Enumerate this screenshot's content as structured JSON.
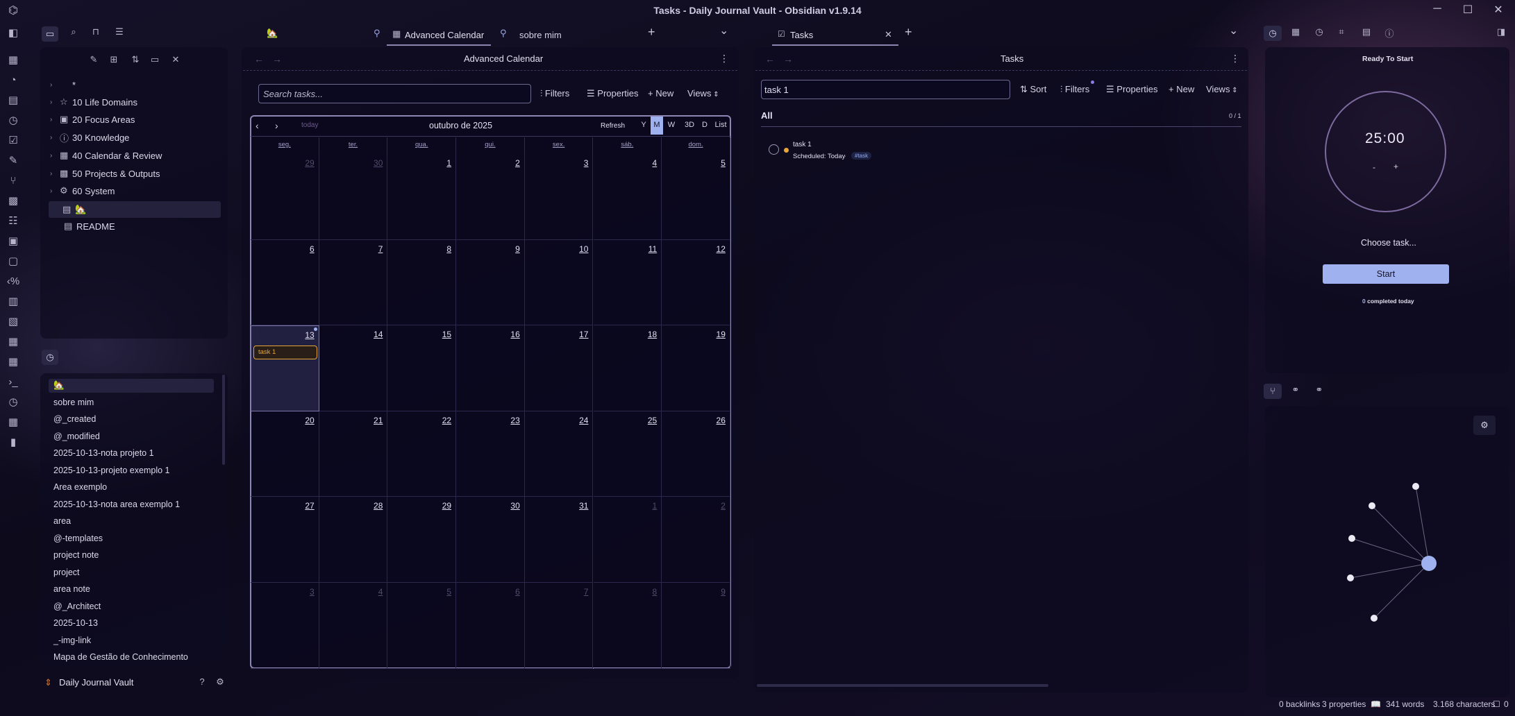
{
  "window": {
    "title": "Tasks - Daily Journal Vault - Obsidian v1.9.14",
    "minimize": "─",
    "maximize": "☐",
    "close": "✕"
  },
  "tabs": {
    "left": [
      {
        "label": "🏡"
      },
      {
        "label": "Advanced Calendar"
      },
      {
        "label": "sobre mim"
      }
    ],
    "right": [
      {
        "label": "Tasks"
      }
    ],
    "new_tab": "+",
    "dropdown": "⌄",
    "close": "✕"
  },
  "file_tree": {
    "items": [
      {
        "label": "*",
        "icon": "none"
      },
      {
        "label": "10 Life Domains",
        "icon": "star-icon"
      },
      {
        "label": "20 Focus Areas",
        "icon": "save-icon"
      },
      {
        "label": "30 Knowledge",
        "icon": "info-icon"
      },
      {
        "label": "40 Calendar & Review",
        "icon": "calendar-icon"
      },
      {
        "label": "50 Projects & Outputs",
        "icon": "grid-icon"
      },
      {
        "label": "60 System",
        "icon": "gear-icon"
      },
      {
        "label": "🏡",
        "icon": "file-icon"
      },
      {
        "label": "README",
        "icon": "file-icon"
      }
    ]
  },
  "recent_files": [
    "🏡",
    "sobre mim",
    "@_created",
    "@_modified",
    "2025-10-13-nota projeto 1",
    "2025-10-13-projeto exemplo 1",
    "Area exemplo",
    "2025-10-13-nota area exemplo 1",
    "area",
    "@-templates",
    "project note",
    "project",
    "area note",
    "@_Architect",
    "2025-10-13",
    "_-img-link",
    "Mapa de Gestão de Conhecimento"
  ],
  "vault": {
    "name": "Daily Journal Vault"
  },
  "calendar": {
    "view_title": "Advanced Calendar",
    "search_placeholder": "Search tasks...",
    "filters": "Filters",
    "properties": "Properties",
    "new": "New",
    "views": "Views",
    "today": "today",
    "month_title": "outubro de 2025",
    "refresh": "Refresh",
    "views_buttons": [
      "Y",
      "M",
      "W",
      "3D",
      "D",
      "List"
    ],
    "active_view": "M",
    "weekdays": [
      "seg.",
      "ter.",
      "qua.",
      "qui.",
      "sex.",
      "sáb.",
      "dom."
    ],
    "weeks": [
      [
        {
          "d": "29",
          "dim": true
        },
        {
          "d": "30",
          "dim": true
        },
        {
          "d": "1"
        },
        {
          "d": "2"
        },
        {
          "d": "3"
        },
        {
          "d": "4"
        },
        {
          "d": "5"
        }
      ],
      [
        {
          "d": "6"
        },
        {
          "d": "7"
        },
        {
          "d": "8"
        },
        {
          "d": "9"
        },
        {
          "d": "10"
        },
        {
          "d": "11"
        },
        {
          "d": "12"
        }
      ],
      [
        {
          "d": "13",
          "today": true
        },
        {
          "d": "14"
        },
        {
          "d": "15"
        },
        {
          "d": "16"
        },
        {
          "d": "17"
        },
        {
          "d": "18"
        },
        {
          "d": "19"
        }
      ],
      [
        {
          "d": "20"
        },
        {
          "d": "21"
        },
        {
          "d": "22"
        },
        {
          "d": "23"
        },
        {
          "d": "24"
        },
        {
          "d": "25"
        },
        {
          "d": "26"
        }
      ],
      [
        {
          "d": "27"
        },
        {
          "d": "28"
        },
        {
          "d": "29"
        },
        {
          "d": "30"
        },
        {
          "d": "31"
        },
        {
          "d": "1",
          "dim": true
        },
        {
          "d": "2",
          "dim": true
        }
      ],
      [
        {
          "d": "3",
          "dim": true
        },
        {
          "d": "4",
          "dim": true
        },
        {
          "d": "5",
          "dim": true
        },
        {
          "d": "6",
          "dim": true
        },
        {
          "d": "7",
          "dim": true
        },
        {
          "d": "8",
          "dim": true
        },
        {
          "d": "9",
          "dim": true
        }
      ]
    ],
    "event": {
      "label": "task 1",
      "color": "#e8a53a"
    }
  },
  "tasks": {
    "view_title": "Tasks",
    "search_value": "task 1",
    "sort": "Sort",
    "filters": "Filters",
    "properties": "Properties",
    "new": "New",
    "views": "Views",
    "group": "All",
    "count": "0 / 1",
    "items": [
      {
        "title": "task 1",
        "scheduled": "Scheduled: Today",
        "tag": "#task"
      }
    ]
  },
  "pomodoro": {
    "status": "Ready To Start",
    "time": "25:00",
    "minus": "-",
    "plus": "+",
    "choose": "Choose task...",
    "start": "Start",
    "completed_num": "0",
    "completed_label": "completed today"
  },
  "status": {
    "backlinks": "0 backlinks",
    "properties": "3 properties",
    "words": "341 words",
    "characters": "3.168 characters",
    "comments": "0"
  },
  "colors": {
    "accent": "#9fb1ee",
    "bg": "#0e0b1e",
    "event": "#e8a53a"
  }
}
